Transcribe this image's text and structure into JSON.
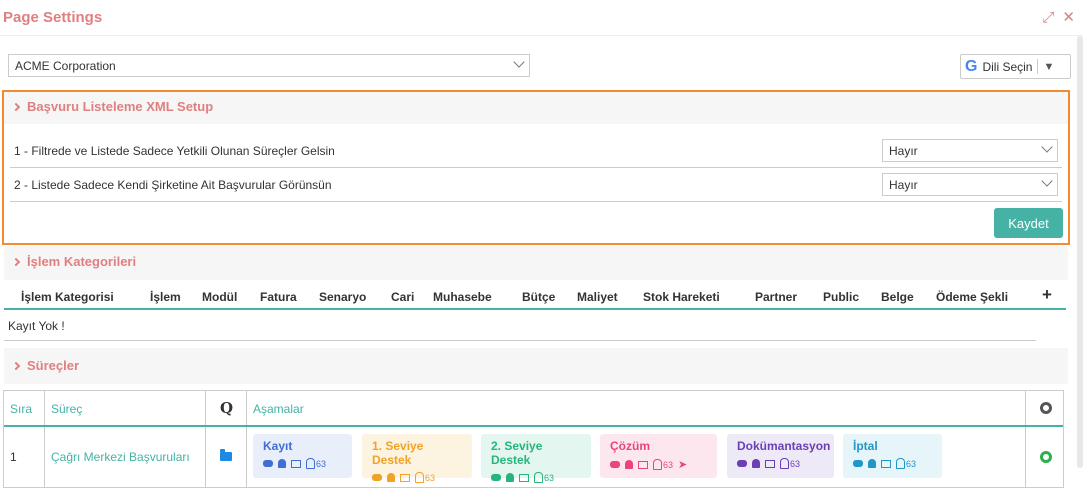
{
  "window": {
    "title": "Page Settings",
    "maximize_glyph": "⤢",
    "close_glyph": "✕"
  },
  "company_select": {
    "value": "ACME Corporation"
  },
  "language": {
    "google_glyph": "G",
    "label": "Dili Seçin",
    "dropdown_glyph": "▼"
  },
  "xml_section": {
    "title": "Başvuru Listeleme XML Setup",
    "rows": [
      {
        "label": "1 - Filtrede ve Listede Sadece Yetkili Olunan Süreçler Gelsin",
        "value": "Hayır"
      },
      {
        "label": "2 - Listede Sadece Kendi Şirketine Ait Başvurular Görünsün",
        "value": "Hayır"
      }
    ],
    "save_label": "Kaydet"
  },
  "category_section": {
    "title": "İşlem Kategorileri",
    "columns": [
      "İşlem Kategorisi",
      "İşlem",
      "Modül",
      "Fatura",
      "Senaryo",
      "Cari",
      "Muhasebe",
      "Bütçe",
      "Maliyet",
      "Stok Hareketi",
      "Partner",
      "Public",
      "Belge",
      "Ödeme Şekli"
    ],
    "add_glyph": "+",
    "empty_text": "Kayıt Yok !"
  },
  "process_section": {
    "title": "Süreçler",
    "columns": {
      "order": "Sıra",
      "process": "Süreç",
      "query": "Q",
      "stages": "Aşamalar"
    },
    "rows": [
      {
        "order": "1",
        "name": "Çağrı Merkezi Başvuruları",
        "stages": [
          {
            "name": "Kayıt",
            "count": "63"
          },
          {
            "name": "1. Seviye Destek",
            "count": "63"
          },
          {
            "name": "2. Seviye Destek",
            "count": "63"
          },
          {
            "name": "Çözüm",
            "count": "63"
          },
          {
            "name": "Dokümantasyon",
            "count": "63"
          },
          {
            "name": "İptal",
            "count": "63"
          }
        ]
      }
    ]
  },
  "colors": {
    "accent_red": "#e07f7f",
    "teal": "#45b2a5",
    "highlight_orange": "#f28a2f",
    "stage_kayit": "#3f6fd1",
    "stage_seviye1": "#f0a326",
    "stage_seviye2": "#26b57b",
    "stage_cozum": "#e8457a",
    "stage_dokuman": "#6a3fb5",
    "stage_iptal": "#2196c9"
  }
}
